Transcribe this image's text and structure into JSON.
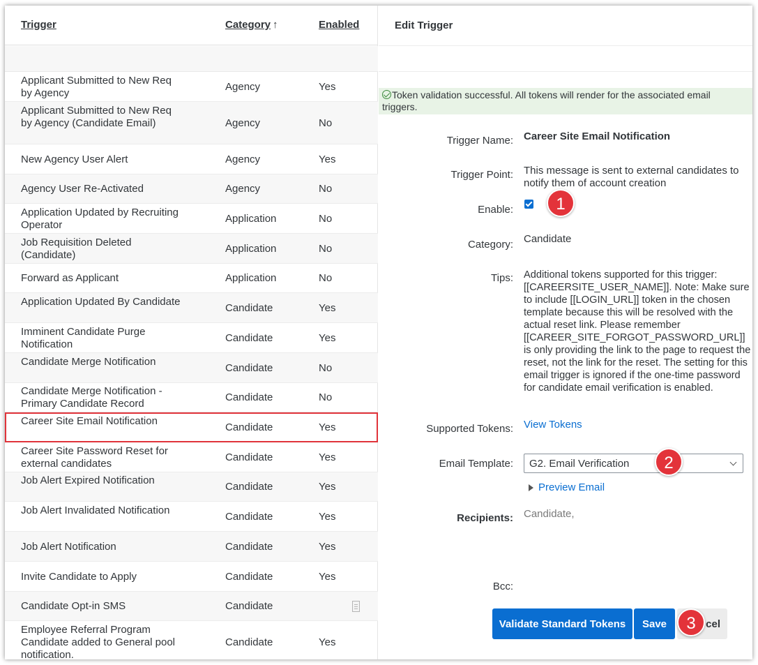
{
  "table": {
    "headers": {
      "trigger": "Trigger",
      "category": "Category",
      "sort_arrow": "↑",
      "enabled": "Enabled"
    },
    "rows": [
      {
        "trigger": "Applicant Submitted to New Req by Agency",
        "category": "Agency",
        "enabled": "Yes"
      },
      {
        "trigger": "Applicant Submitted to New Req by Agency (Candidate Email)",
        "category": "Agency",
        "enabled": "No"
      },
      {
        "trigger": "New Agency User Alert",
        "category": "Agency",
        "enabled": "Yes"
      },
      {
        "trigger": "Agency User Re-Activated",
        "category": "Agency",
        "enabled": "No"
      },
      {
        "trigger": "Application Updated by Recruiting Operator",
        "category": "Application",
        "enabled": "No"
      },
      {
        "trigger": "Job Requisition Deleted (Candidate)",
        "category": "Application",
        "enabled": "No"
      },
      {
        "trigger": "Forward as Applicant",
        "category": "Application",
        "enabled": "No"
      },
      {
        "trigger": "Application Updated By Candidate",
        "category": "Candidate",
        "enabled": "Yes"
      },
      {
        "trigger": "Imminent Candidate Purge Notification",
        "category": "Candidate",
        "enabled": "Yes"
      },
      {
        "trigger": "Candidate Merge Notification",
        "category": "Candidate",
        "enabled": "No"
      },
      {
        "trigger": "Candidate Merge Notification - Primary Candidate Record",
        "category": "Candidate",
        "enabled": "No"
      },
      {
        "trigger": "Career Site Email Notification",
        "category": "Candidate",
        "enabled": "Yes"
      },
      {
        "trigger": "Career Site Password Reset for external candidates",
        "category": "Candidate",
        "enabled": "Yes"
      },
      {
        "trigger": "Job Alert Expired Notification",
        "category": "Candidate",
        "enabled": "Yes"
      },
      {
        "trigger": "Job Alert Invalidated Notification",
        "category": "Candidate",
        "enabled": "Yes"
      },
      {
        "trigger": "Job Alert Notification",
        "category": "Candidate",
        "enabled": "Yes"
      },
      {
        "trigger": "Invite Candidate to Apply",
        "category": "Candidate",
        "enabled": "Yes"
      },
      {
        "trigger": "Candidate Opt-in SMS",
        "category": "Candidate",
        "enabled": ""
      },
      {
        "trigger": "Employee Referral Program Candidate added to General pool notification.",
        "category": "Candidate",
        "enabled": "Yes"
      }
    ]
  },
  "edit": {
    "title": "Edit Trigger",
    "success_message": "Token validation successful. All tokens will render for the associated email triggers.",
    "labels": {
      "trigger_name": "Trigger Name:",
      "trigger_point": "Trigger Point:",
      "enable": "Enable:",
      "category": "Category:",
      "tips": "Tips:",
      "supported_tokens": "Supported Tokens:",
      "email_template": "Email Template:",
      "recipients": "Recipients:",
      "bcc": "Bcc:"
    },
    "values": {
      "trigger_name": "Career Site Email Notification",
      "trigger_point": "This message is sent to external candidates to notify them of account creation",
      "category": "Candidate",
      "tips": "Additional tokens supported for this trigger: [[CAREERSITE_USER_NAME]]. Note: Make sure to include [[LOGIN_URL]] token in the chosen template because this will be resolved with the actual reset link. Please remember [[CAREER_SITE_FORGOT_PASSWORD_URL]] is only providing the link to the page to request the reset, not the link for the reset. The setting for this email trigger is ignored if the one-time password for candidate email verification is enabled.",
      "view_tokens": "View Tokens",
      "email_template": "G2. Email Verification",
      "preview_email": "Preview Email",
      "recipients": "Candidate,"
    },
    "buttons": {
      "validate": "Validate Standard Tokens",
      "save": "Save",
      "cancel": "cel"
    }
  },
  "badges": [
    "1",
    "2",
    "3"
  ]
}
